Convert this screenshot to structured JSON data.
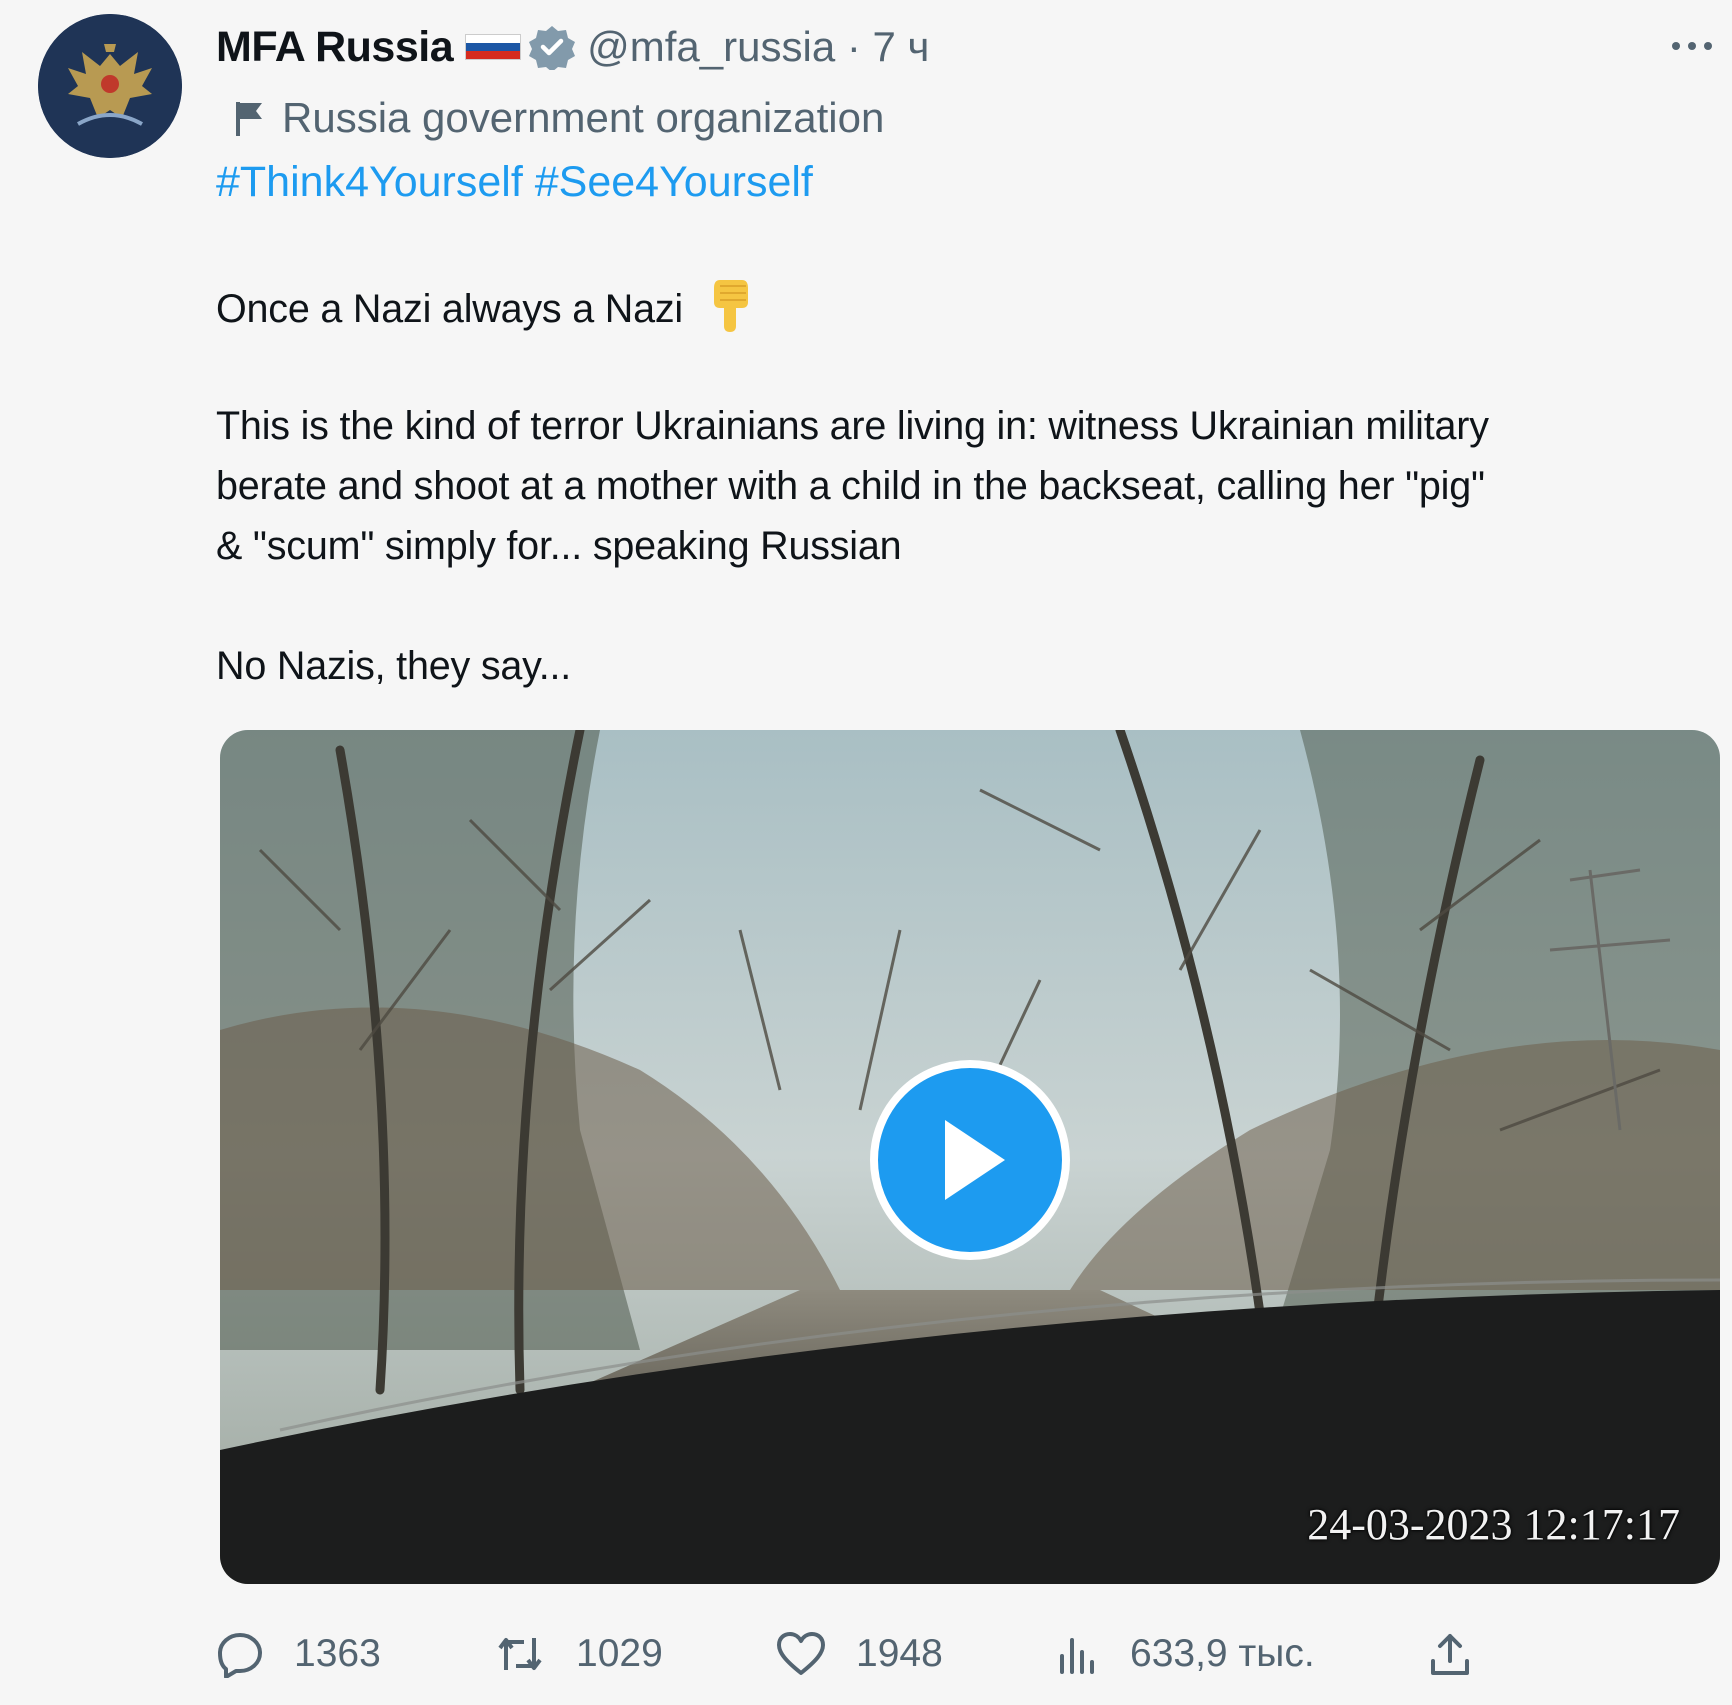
{
  "post": {
    "author_name": "MFA Russia",
    "handle": "@mfa_russia",
    "separator": "·",
    "time": "7 ч",
    "handle_line": "@mfa_russia · 7 ч",
    "affiliation_label": "Russia government organization",
    "hashtags": [
      "#Think4Yourself",
      "#See4Yourself"
    ],
    "lines": [
      "Once a Nazi always a Nazi",
      "This is the kind of terror Ukrainians are living in: witness Ukrainian military",
      "berate and shoot at a mother with a child in the backseat, calling her \"pig\"",
      "& \"scum\" simply for... speaking Russian",
      "No Nazis, they say..."
    ],
    "emoji": "👇"
  },
  "video": {
    "timestamp": "24-03-2023 12:17:17"
  },
  "actions": {
    "replies": "1363",
    "reposts": "1029",
    "likes": "1948",
    "views": "633,9 тыс."
  },
  "icons": {
    "avatar": "double-headed-eagle-emblem",
    "verified": "verified-badge-icon",
    "flag": "russian-flag",
    "label": "flag-icon",
    "more": "more-icon",
    "play": "play-icon",
    "reply": "reply-icon",
    "repost": "repost-icon",
    "like": "like-icon",
    "views": "views-icon",
    "share": "share-icon"
  },
  "colors": {
    "accent": "#1d9bf0",
    "text": "#0f1419",
    "secondary": "#536471",
    "background": "#f6f6f6",
    "avatar_bg": "#1f3456",
    "emoji": "#f5c542"
  }
}
